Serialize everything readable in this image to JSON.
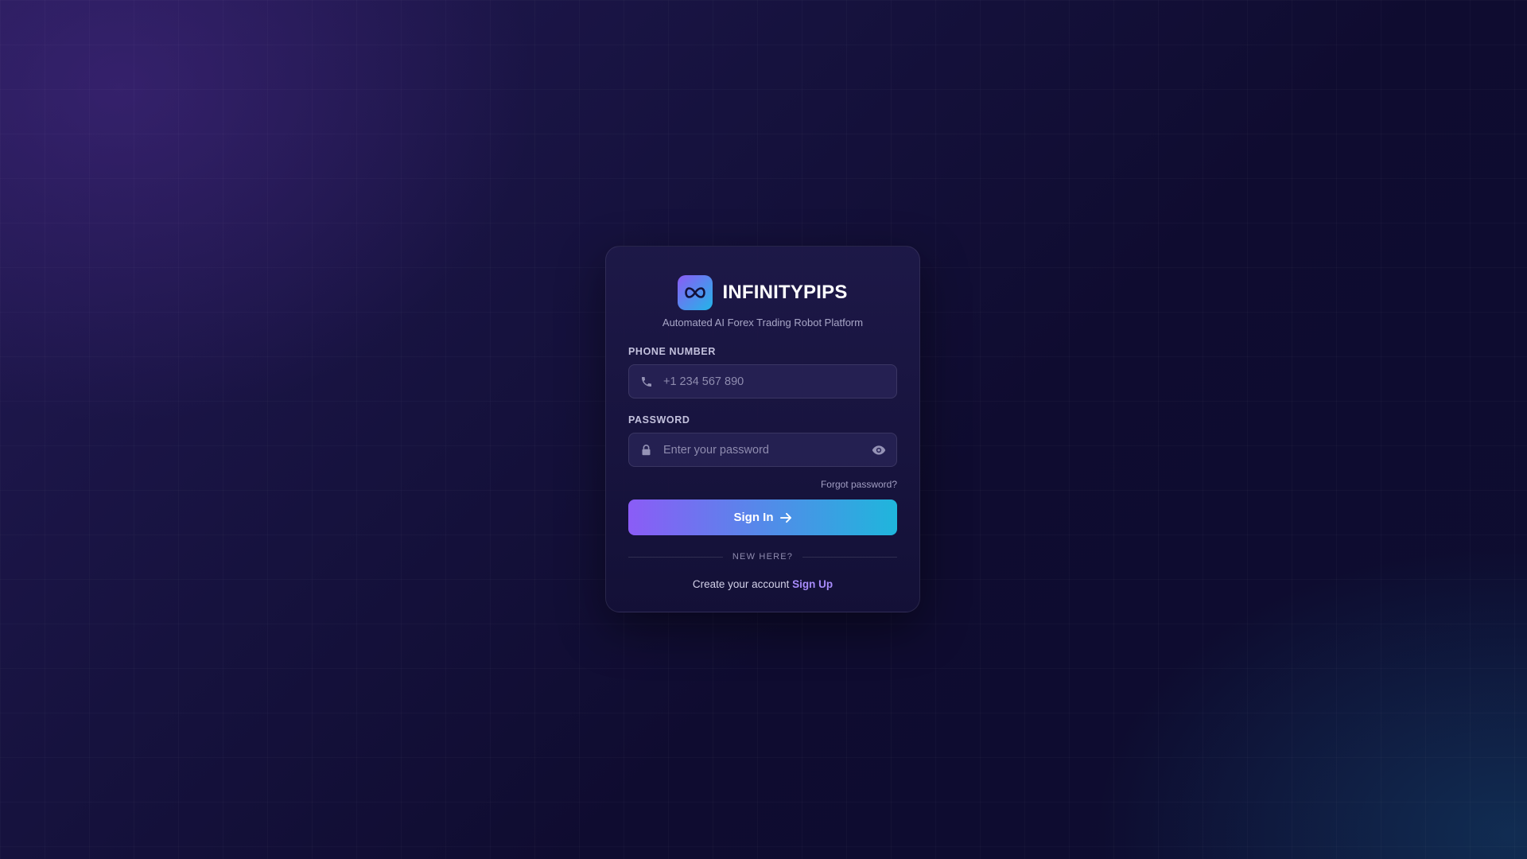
{
  "app": {
    "name": "INFINITYPIPS",
    "tagline": "Automated AI Forex Trading Robot Platform",
    "logo_icon": "infinity-icon"
  },
  "form": {
    "phone": {
      "label": "PHONE NUMBER",
      "placeholder": "+1 234 567 890",
      "value": "",
      "icon": "phone-icon"
    },
    "password": {
      "label": "PASSWORD",
      "placeholder": "Enter your password",
      "value": "",
      "icon": "lock-icon",
      "toggle_icon": "eye-icon"
    },
    "forgot_label": "Forgot password?",
    "submit_label": "Sign In",
    "submit_icon": "arrow-right-icon"
  },
  "footer": {
    "divider_text": "NEW HERE?",
    "prompt": "Create your account",
    "signup_label": "Sign Up"
  },
  "colors": {
    "accent_purple": "#8b5cf6",
    "accent_cyan": "#1fb6dc",
    "link": "#a78bfa"
  }
}
